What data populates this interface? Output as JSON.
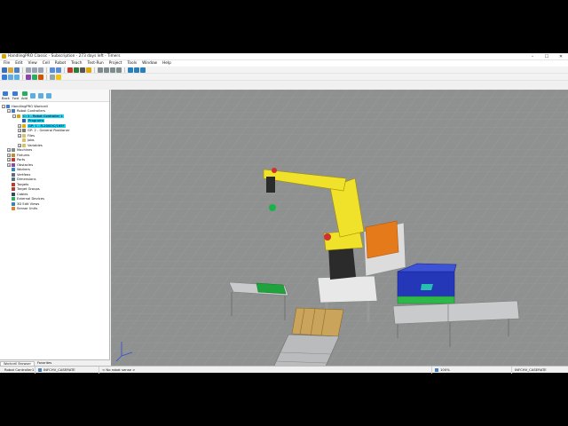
{
  "window": {
    "title": "HandlingPRO Classic - Subscription - 273 days left - Timers",
    "minimize": "–",
    "maximize": "☐",
    "close": "✕"
  },
  "menu": [
    "File",
    "Edit",
    "View",
    "Cell",
    "Robot",
    "Teach",
    "Test-Run",
    "Project",
    "Tools",
    "Window",
    "Help"
  ],
  "panel": {
    "toolbar": [
      "Back",
      "Fwd",
      "Add"
    ],
    "tree": [
      {
        "label": "HandlingPRO Workcell",
        "indent": 0,
        "toggle": "−",
        "icon": "#3a7bd5",
        "highlight": false
      },
      {
        "label": "Robot Controllers",
        "indent": 1,
        "toggle": "−",
        "icon": "#3a7bd5",
        "highlight": false
      },
      {
        "label": "C: 1 - Robot Controller 1",
        "indent": 2,
        "toggle": "−",
        "icon": "#d9a300",
        "highlight": true
      },
      {
        "label": "Programs",
        "indent": 3,
        "toggle": "",
        "icon": "#2f5fa8",
        "highlight": true
      },
      {
        "label": "GP: 1 - R-2000iC/165F",
        "indent": 3,
        "toggle": "+",
        "icon": "#e0b000",
        "highlight": true
      },
      {
        "label": "GP: 2 - General Positioner",
        "indent": 3,
        "toggle": "+",
        "icon": "#7a7a7a",
        "highlight": false
      },
      {
        "label": "Files",
        "indent": 3,
        "toggle": "+",
        "icon": "#d9c36a",
        "highlight": false
      },
      {
        "label": "Jobs",
        "indent": 3,
        "toggle": "",
        "icon": "#d9c36a",
        "highlight": false
      },
      {
        "label": "Variables",
        "indent": 3,
        "toggle": "+",
        "icon": "#d9c36a",
        "highlight": false
      },
      {
        "label": "Machines",
        "indent": 1,
        "toggle": "+",
        "icon": "#7f8c8d",
        "highlight": false
      },
      {
        "label": "Fixtures",
        "indent": 1,
        "toggle": "+",
        "icon": "#c28b2c",
        "highlight": false
      },
      {
        "label": "Parts",
        "indent": 1,
        "toggle": "+",
        "icon": "#c0392b",
        "highlight": false
      },
      {
        "label": "Obstacles",
        "indent": 1,
        "toggle": "+",
        "icon": "#8e44ad",
        "highlight": false
      },
      {
        "label": "Workers",
        "indent": 1,
        "toggle": "",
        "icon": "#2e86c1",
        "highlight": false
      },
      {
        "label": "Vertfeex",
        "indent": 1,
        "toggle": "",
        "icon": "#5d6d7e",
        "highlight": false
      },
      {
        "label": "Dimensions",
        "indent": 1,
        "toggle": "",
        "icon": "#5d6d7e",
        "highlight": false
      },
      {
        "label": "Targets",
        "indent": 1,
        "toggle": "",
        "icon": "#c0392b",
        "highlight": false
      },
      {
        "label": "Target Groups",
        "indent": 1,
        "toggle": "",
        "icon": "#c0392b",
        "highlight": false
      },
      {
        "label": "Cables",
        "indent": 1,
        "toggle": "",
        "icon": "#34495e",
        "highlight": false
      },
      {
        "label": "External Devices",
        "indent": 1,
        "toggle": "",
        "icon": "#27ae60",
        "highlight": false
      },
      {
        "label": "3D Edit Views",
        "indent": 1,
        "toggle": "",
        "icon": "#2e86c1",
        "highlight": false
      },
      {
        "label": "Sensor Units",
        "indent": 1,
        "toggle": "",
        "icon": "#e67e22",
        "highlight": false
      }
    ],
    "tabs": [
      "Workcell Browser",
      "Favorites"
    ]
  },
  "status": {
    "controller": "Robot Controller1",
    "program": "INFCHV_CASERATE",
    "sensor": "< No robot sense >",
    "zoom": "100%",
    "program_right": "INFCHV_CASERATE"
  }
}
